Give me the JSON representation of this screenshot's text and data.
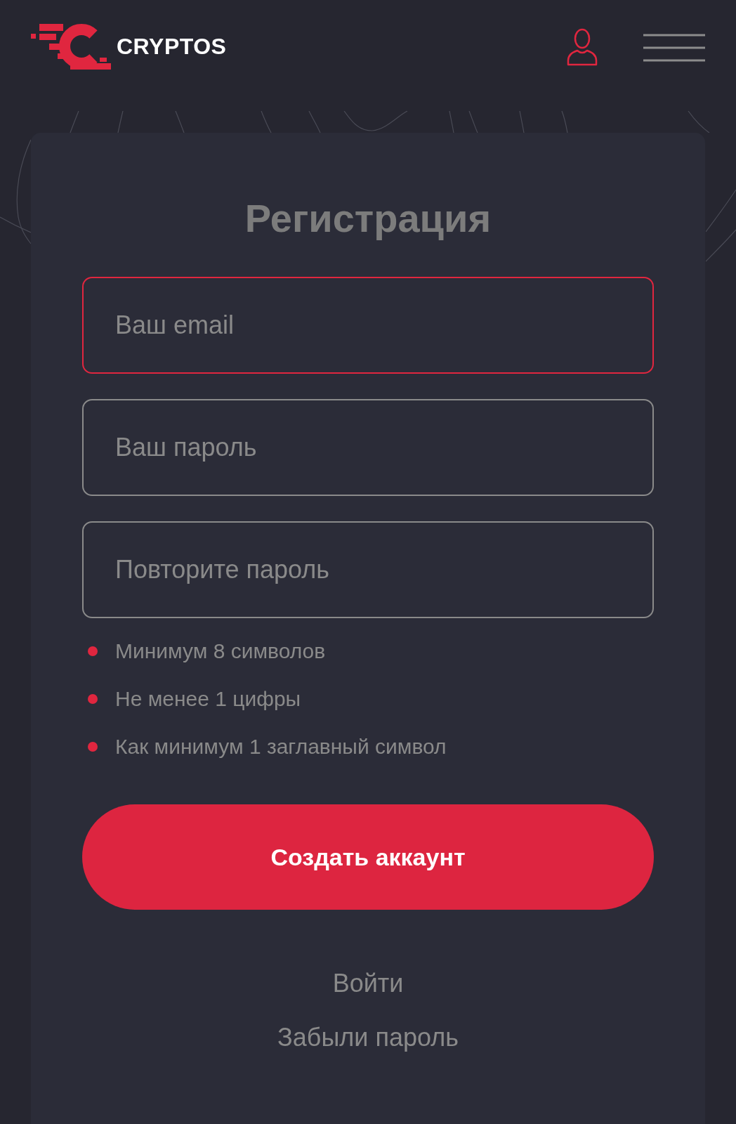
{
  "header": {
    "logo_text": "CRYPTOS"
  },
  "form": {
    "title": "Регистрация",
    "fields": [
      {
        "placeholder": "Ваш email",
        "focused": true
      },
      {
        "placeholder": "Ваш пароль",
        "focused": false
      },
      {
        "placeholder": "Повторите пароль",
        "focused": false
      }
    ],
    "requirements": [
      "Минимум 8 символов",
      "Не менее 1 цифры",
      "Как минимум 1 заглавный символ"
    ],
    "submit_button": "Создать аккаунт",
    "links": [
      "Войти",
      "Забыли пароль"
    ]
  }
}
